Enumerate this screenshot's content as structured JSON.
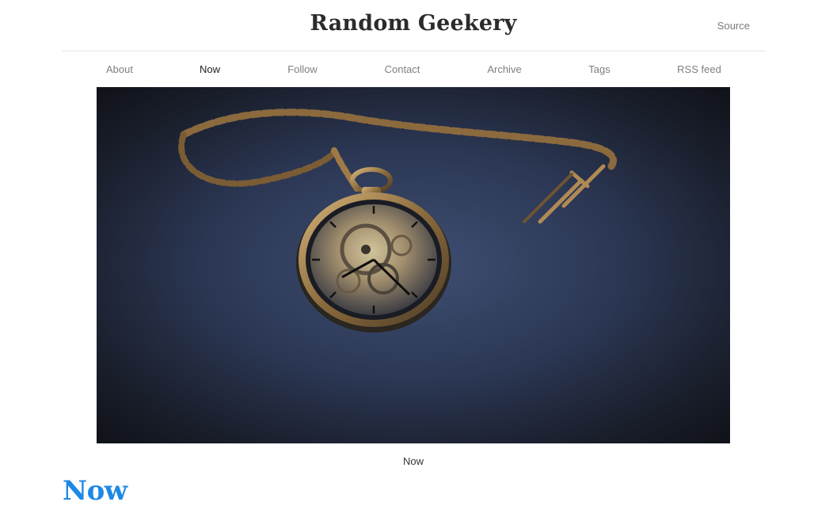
{
  "site": {
    "title": "Random Geekery",
    "source_label": "Source"
  },
  "nav": {
    "items": [
      {
        "label": "About",
        "active": false
      },
      {
        "label": "Now",
        "active": true
      },
      {
        "label": "Follow",
        "active": false
      },
      {
        "label": "Contact",
        "active": false
      },
      {
        "label": "Archive",
        "active": false
      },
      {
        "label": "Tags",
        "active": false
      },
      {
        "label": "RSS feed",
        "active": false
      }
    ]
  },
  "hero": {
    "caption": "Now",
    "icon": "pocket-watch-photo"
  },
  "page": {
    "heading": "Now"
  },
  "colors": {
    "heading_accent": "#1e88e5",
    "active_nav": "#222222",
    "inactive_nav": "#7f7f7f"
  }
}
